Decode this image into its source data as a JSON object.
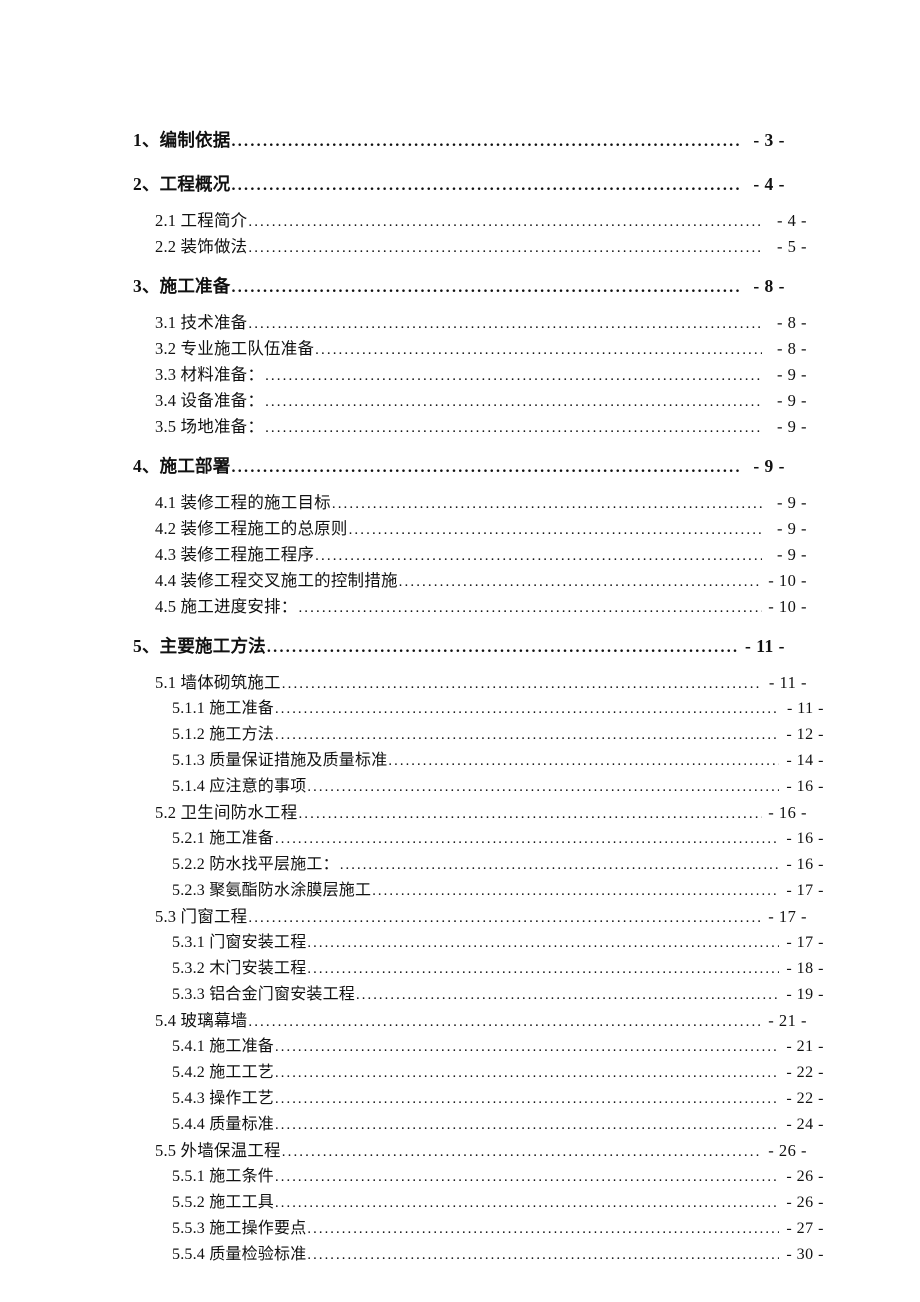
{
  "document": {
    "type": "table-of-contents",
    "page_number_format": "- N -",
    "entries": [
      {
        "level": 1,
        "label": "1、编制依据",
        "page": "- 3 -"
      },
      {
        "level": 1,
        "label": "2、工程概况",
        "page": "- 4 -"
      },
      {
        "level": 2,
        "label": "2.1 工程简介",
        "page": "- 4 -"
      },
      {
        "level": 2,
        "label": "2.2 装饰做法",
        "page": "- 5 -"
      },
      {
        "level": 1,
        "label": "3、施工准备",
        "page": "- 8 -"
      },
      {
        "level": 2,
        "label": "3.1 技术准备",
        "page": "- 8 -"
      },
      {
        "level": 2,
        "label": "3.2 专业施工队伍准备",
        "page": "- 8 -"
      },
      {
        "level": 2,
        "label": "3.3 材料准备：",
        "page": "- 9 -"
      },
      {
        "level": 2,
        "label": "3.4 设备准备：",
        "page": "- 9 -"
      },
      {
        "level": 2,
        "label": "3.5 场地准备：",
        "page": "- 9 -"
      },
      {
        "level": 1,
        "label": "4、施工部署",
        "page": "- 9 -"
      },
      {
        "level": 2,
        "label": "4.1 装修工程的施工目标",
        "page": "- 9 -"
      },
      {
        "level": 2,
        "label": "4.2 装修工程施工的总原则",
        "page": "- 9 -"
      },
      {
        "level": 2,
        "label": "4.3 装修工程施工程序",
        "page": "- 9 -"
      },
      {
        "level": 2,
        "label": "4.4 装修工程交叉施工的控制措施",
        "page": "- 10 -"
      },
      {
        "level": 2,
        "label": "4.5 施工进度安排：",
        "page": "- 10 -"
      },
      {
        "level": 1,
        "label": "5、主要施工方法",
        "page": "- 11 -"
      },
      {
        "level": 2,
        "label": "5.1 墙体砌筑施工",
        "page": "- 11 -"
      },
      {
        "level": 3,
        "label": "5.1.1 施工准备",
        "page": "- 11 -"
      },
      {
        "level": 3,
        "label": "5.1.2 施工方法",
        "page": "- 12 -"
      },
      {
        "level": 3,
        "label": "5.1.3 质量保证措施及质量标准",
        "page": "- 14 -"
      },
      {
        "level": 3,
        "label": "5.1.4 应注意的事项",
        "page": "- 16 -"
      },
      {
        "level": 2,
        "label": "5.2 卫生间防水工程",
        "page": "- 16 -"
      },
      {
        "level": 3,
        "label": "5.2.1 施工准备",
        "page": "- 16 -"
      },
      {
        "level": 3,
        "label": "5.2.2 防水找平层施工：",
        "page": "- 16 -"
      },
      {
        "level": 3,
        "label": "5.2.3 聚氨酯防水涂膜层施工",
        "page": "- 17 -"
      },
      {
        "level": 2,
        "label": "5.3 门窗工程",
        "page": "- 17 -"
      },
      {
        "level": 3,
        "label": "5.3.1 门窗安装工程",
        "page": "- 17 -"
      },
      {
        "level": 3,
        "label": "5.3.2 木门安装工程",
        "page": "- 18 -"
      },
      {
        "level": 3,
        "label": "5.3.3 铝合金门窗安装工程",
        "page": "- 19 -"
      },
      {
        "level": 2,
        "label": "5.4 玻璃幕墙",
        "page": "- 21 -"
      },
      {
        "level": 3,
        "label": "5.4.1 施工准备",
        "page": "- 21 -"
      },
      {
        "level": 3,
        "label": "5.4.2 施工工艺",
        "page": "- 22 -"
      },
      {
        "level": 3,
        "label": "5.4.3 操作工艺",
        "page": "- 22 -"
      },
      {
        "level": 3,
        "label": "5.4.4 质量标准",
        "page": "- 24 -"
      },
      {
        "level": 2,
        "label": "5.5 外墙保温工程",
        "page": "- 26 -"
      },
      {
        "level": 3,
        "label": "5.5.1 施工条件",
        "page": "- 26 -"
      },
      {
        "level": 3,
        "label": "5.5.2 施工工具",
        "page": "- 26 -"
      },
      {
        "level": 3,
        "label": "5.5.3 施工操作要点",
        "page": "- 27 -"
      },
      {
        "level": 3,
        "label": "5.5.4 质量检验标准",
        "page": "- 30 -"
      }
    ]
  }
}
